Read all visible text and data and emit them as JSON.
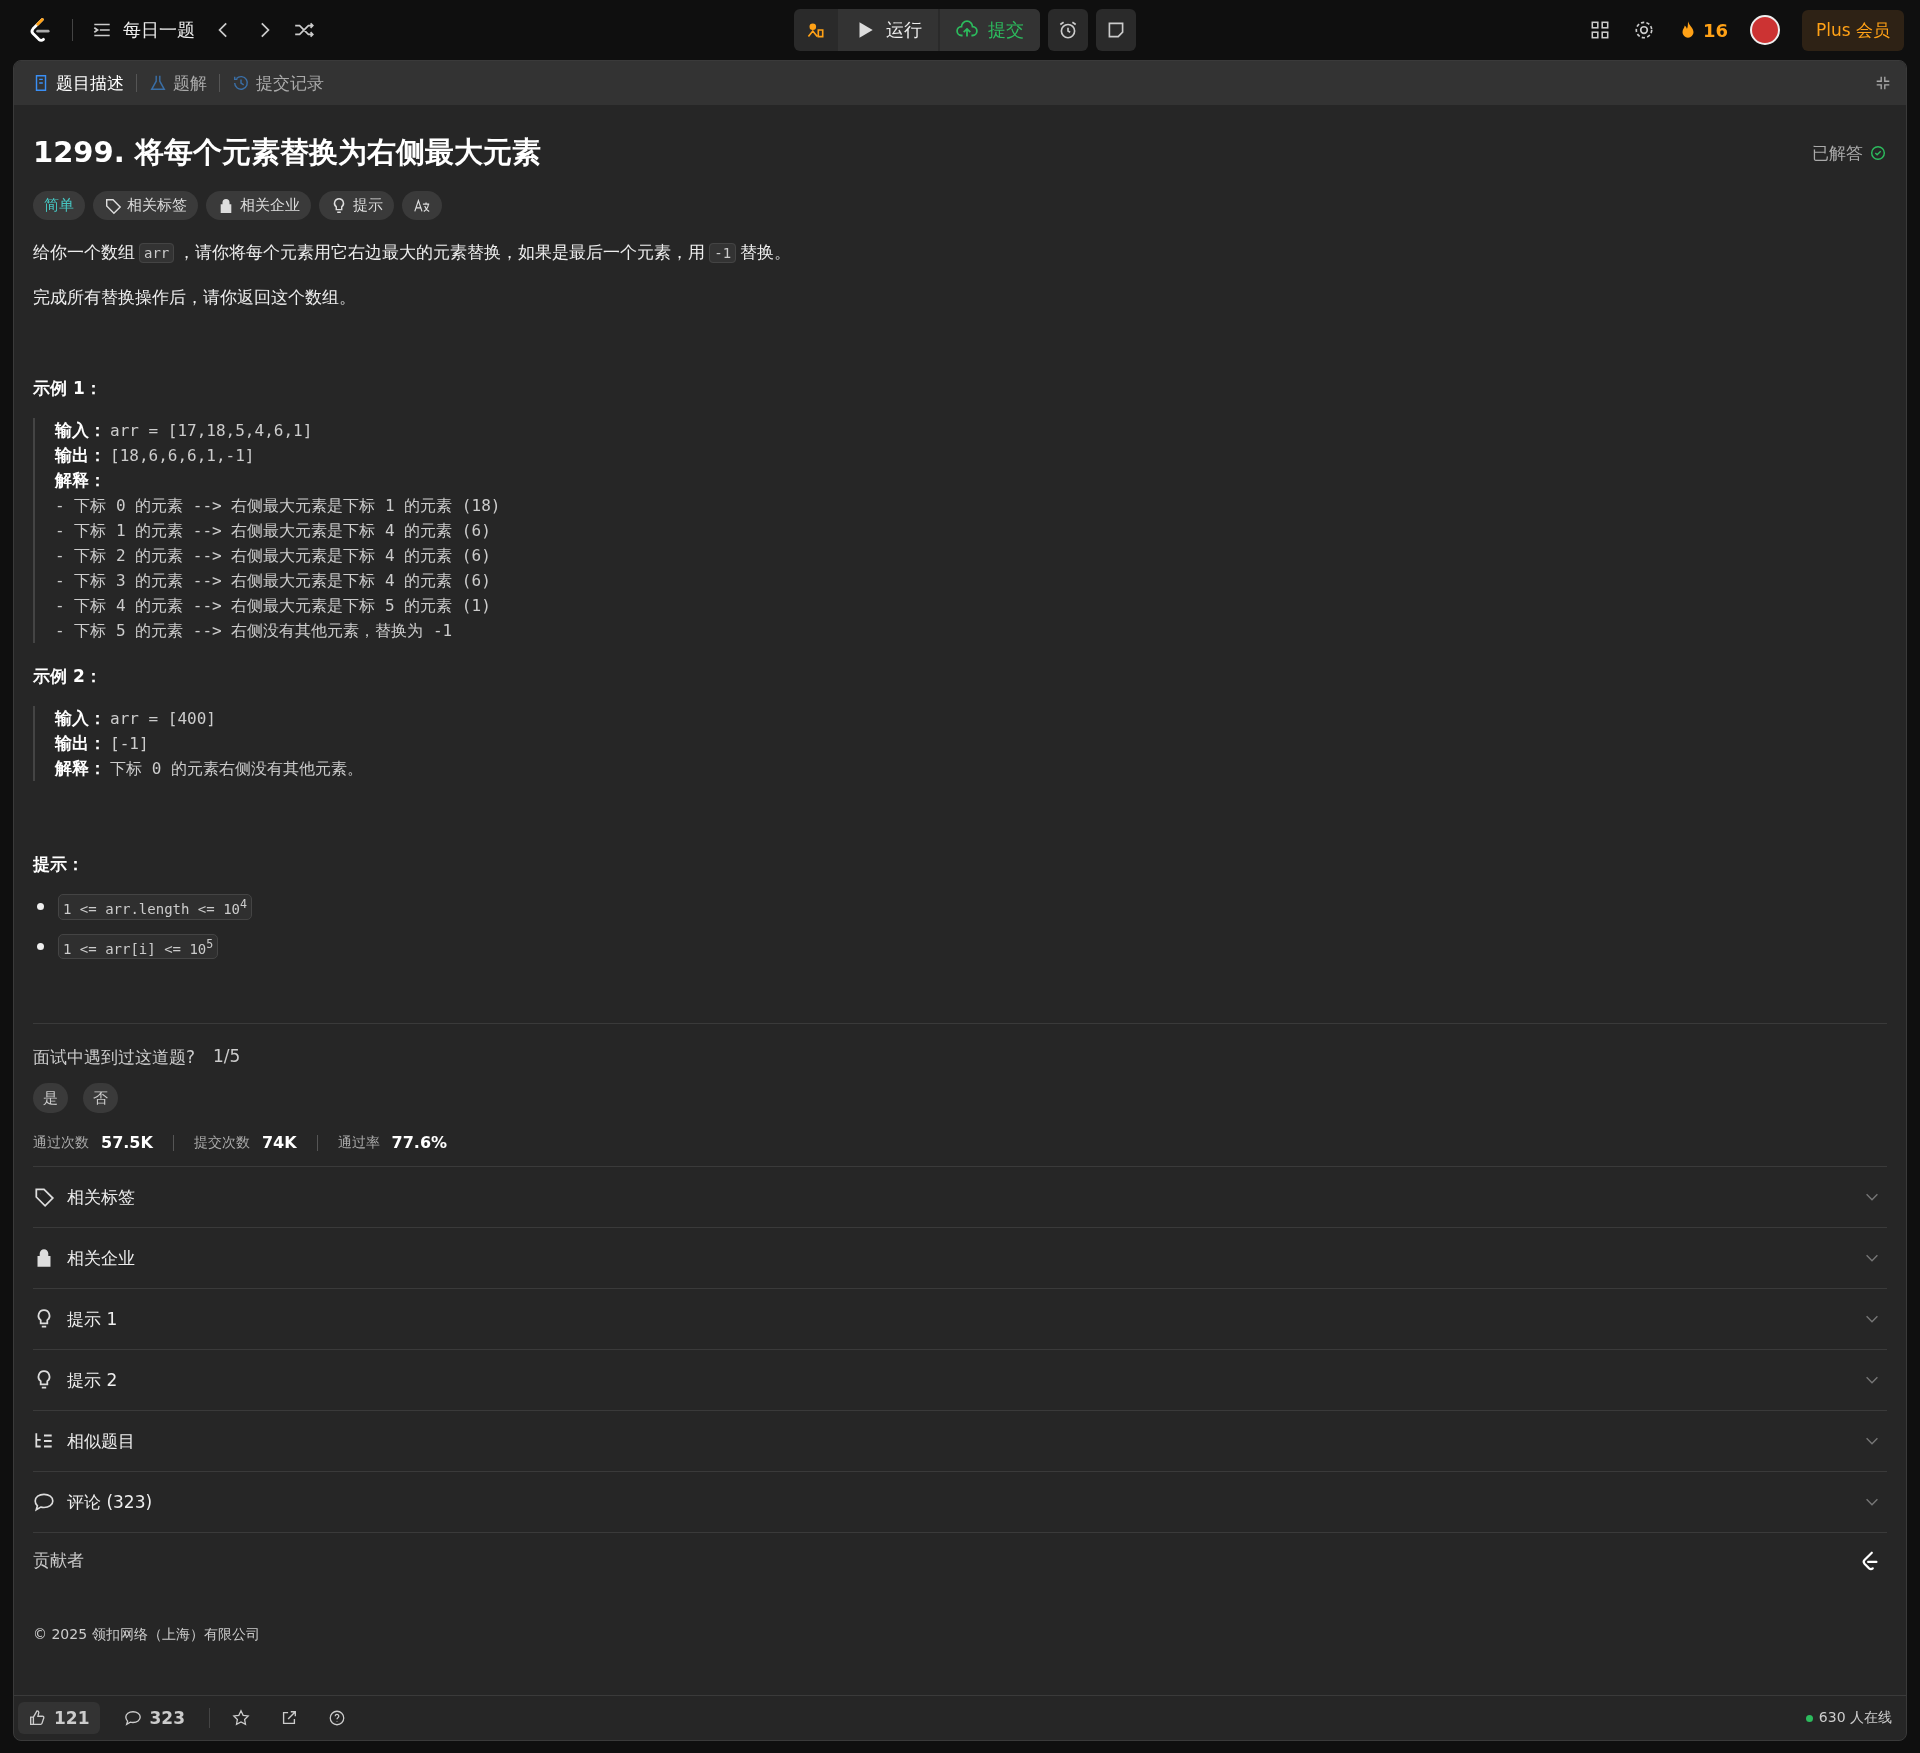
{
  "topbar": {
    "title": "每日一题",
    "run": "运行",
    "submit": "提交",
    "streak": "16",
    "plus": "Plus 会员"
  },
  "tabs": [
    {
      "label": "题目描述",
      "selected": true,
      "kind": "doc"
    },
    {
      "label": "题解",
      "selected": false,
      "kind": "flask"
    },
    {
      "label": "提交记录",
      "selected": false,
      "kind": "history"
    }
  ],
  "problem": {
    "title": "1299. 将每个元素替换为右侧最大元素",
    "status": "已解答",
    "chips": [
      {
        "kind": "difficulty",
        "label": "简单"
      },
      {
        "kind": "tag",
        "label": "相关标签"
      },
      {
        "kind": "lock",
        "label": "相关企业"
      },
      {
        "kind": "hint",
        "label": "提示"
      },
      {
        "kind": "translate"
      }
    ],
    "paragraphs": [
      [
        {
          "kind": "text",
          "text": "给你一个数组"
        },
        {
          "kind": "code",
          "text": "arr"
        },
        {
          "kind": "text",
          "text": "，请你将每个元素用它右边最大的元素替换，如果是最后一个元素，用"
        },
        {
          "kind": "code",
          "text": "-1"
        },
        {
          "kind": "text",
          "text": "替换。"
        }
      ],
      [
        {
          "kind": "text",
          "text": "完成所有替换操作后，请你返回这个数组。"
        }
      ]
    ],
    "examples": [
      {
        "heading": "示例 1：",
        "lines": [
          {
            "label": "输入：",
            "text": "arr = [17,18,5,4,6,1]"
          },
          {
            "label": "输出：",
            "text": "[18,6,6,6,1,-1]"
          },
          {
            "label": "解释："
          },
          {
            "text": "- 下标 0 的元素 --> 右侧最大元素是下标 1 的元素 (18)"
          },
          {
            "text": "- 下标 1 的元素 --> 右侧最大元素是下标 4 的元素 (6)"
          },
          {
            "text": "- 下标 2 的元素 --> 右侧最大元素是下标 4 的元素 (6)"
          },
          {
            "text": "- 下标 3 的元素 --> 右侧最大元素是下标 4 的元素 (6)"
          },
          {
            "text": "- 下标 4 的元素 --> 右侧最大元素是下标 5 的元素 (1)"
          },
          {
            "text": "- 下标 5 的元素 --> 右侧没有其他元素，替换为 -1"
          }
        ]
      },
      {
        "heading": "示例 2：",
        "lines": [
          {
            "label": "输入：",
            "text": "arr = [400]"
          },
          {
            "label": "输出：",
            "text": "[-1]"
          },
          {
            "label": "解释：",
            "text": "下标 0 的元素右侧没有其他元素。"
          }
        ]
      }
    ],
    "constraints_heading": "提示：",
    "constraints": [
      "1 <= arr.length <= 10$^{4}$",
      "1 <= arr[i] <= 10$^{5}$"
    ]
  },
  "feedback": {
    "question": "面试中遇到过这道题?",
    "count": "1/5",
    "options": [
      "是",
      "否"
    ]
  },
  "stats": [
    {
      "label": "通过次数",
      "value": "57.5K"
    },
    {
      "label": "提交次数",
      "value": "74K"
    },
    {
      "label": "通过率",
      "value": "77.6%"
    }
  ],
  "sections": [
    {
      "kind": "tag",
      "label": "相关标签"
    },
    {
      "kind": "lock",
      "label": "相关企业"
    },
    {
      "kind": "hint",
      "label": "提示 1"
    },
    {
      "kind": "hint",
      "label": "提示 2"
    },
    {
      "kind": "list",
      "label": "相似题目"
    },
    {
      "kind": "comment",
      "label": "评论 (323)"
    }
  ],
  "contributors": "贡献者",
  "copyright": "© 2025 领扣网络（上海）有限公司",
  "bottom_bar": {
    "likes": "121",
    "comments": "323",
    "online": "630 人在线"
  }
}
